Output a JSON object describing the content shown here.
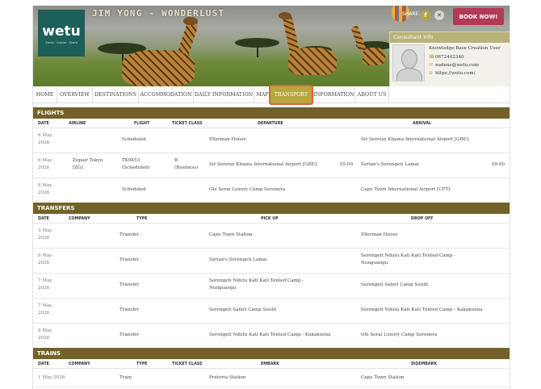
{
  "header": {
    "logo_text": "wetu",
    "logo_tagline": "Travel · Inspire · Share",
    "trip_title": "JIM YONG - WONDERLUST",
    "share_label": "SHARE:",
    "share_icons": [
      "facebook-icon",
      "x-icon"
    ],
    "book_now_label": "BOOK NOW!",
    "colors": {
      "accent": "#b23a55",
      "section_bar": "#72622a",
      "active_tab": "#b9a63e",
      "highlight_border": "#d9653a",
      "logo_bg": "#1c5e58"
    }
  },
  "consultant": {
    "heading": "Consultant Info",
    "name": "Knowledge Base Creation User",
    "phone": "0672442340",
    "email": "nadene@wetu.com",
    "website": "https://wetu.com/"
  },
  "nav": {
    "items": [
      "HOME",
      "OVERVIEW",
      "DESTINATIONS",
      "ACCOMMODATION",
      "DAILY INFORMATION",
      "MAP",
      "TRANSPORT",
      "INFORMATION",
      "ABOUT US"
    ],
    "active": "TRANSPORT"
  },
  "flights": {
    "title": "FLIGHTS",
    "columns": [
      "DATE",
      "AIRLINE",
      "FLIGHT",
      "TICKET CLASS",
      "DEPARTURE",
      "ARRIVAL"
    ],
    "rows": [
      {
        "date": "6 May 2026",
        "airline": "",
        "flight": "Scheduled",
        "ticket_class": "",
        "departure": "Ellerman House",
        "dep_time": "",
        "arrival": "Sir Seretse Khama International Airport [GBE]",
        "arr_time": ""
      },
      {
        "date": "6 May 2026",
        "airline": "Zupair Tokyo [ZG]",
        "flight": "TK9453 (Scheduled)",
        "ticket_class": "B (Business)",
        "departure": "Sir Seretse Khama International Airport [GBE]",
        "dep_time": "05:00",
        "arrival": "Serian's Serengeti Lamai",
        "arr_time": "09:00"
      },
      {
        "date": "8 May 2026",
        "airline": "",
        "flight": "Scheduled",
        "ticket_class": "",
        "departure": "Ole Serai Luxury Camp Seronera",
        "dep_time": "",
        "arrival": "Cape Town International Airport [CPT]",
        "arr_time": ""
      }
    ]
  },
  "transfers": {
    "title": "TRANSFERS",
    "columns": [
      "DATE",
      "COMPANY",
      "TYPE",
      "PICK UP",
      "DROP OFF"
    ],
    "rows": [
      {
        "date": "3 May 2026",
        "company": "",
        "type": "Transfer",
        "pickup": "Cape Town Station",
        "dropoff": "Ellerman House"
      },
      {
        "date": "6 May 2026",
        "company": "",
        "type": "Transfer",
        "pickup": "Serian's Serengeti Lamai",
        "dropoff": "Serengeti Ndutu Kati Kati Tented Camp - Nunguangu"
      },
      {
        "date": "7 May 2026",
        "company": "",
        "type": "Transfer",
        "pickup": "Serengeti Ndutu Kati Kati Tented Camp - Nunguangu",
        "dropoff": "Serengeti Safari Camp South"
      },
      {
        "date": "7 May 2026",
        "company": "",
        "type": "Transfer",
        "pickup": "Serengeti Safari Camp South",
        "dropoff": "Serengeti Ndutu Kati Kati Tented Camp - Kakakuona"
      },
      {
        "date": "8 May 2026",
        "company": "",
        "type": "Transfer",
        "pickup": "Serengeti Ndutu Kati Kati Tented Camp - Kakakuona",
        "dropoff": "Ole Serai Luxury Camp Seronera"
      }
    ]
  },
  "trains": {
    "title": "TRAINS",
    "columns": [
      "DATE",
      "COMPANY",
      "TYPE",
      "TICKET CLASS",
      "EMBARK",
      "DISEMBARK"
    ],
    "rows": [
      {
        "date": "1 May 2026",
        "company": "",
        "type": "Train",
        "ticket_class": "",
        "embark": "Pretoria Station",
        "disembark": "Cape Town Station"
      }
    ]
  }
}
